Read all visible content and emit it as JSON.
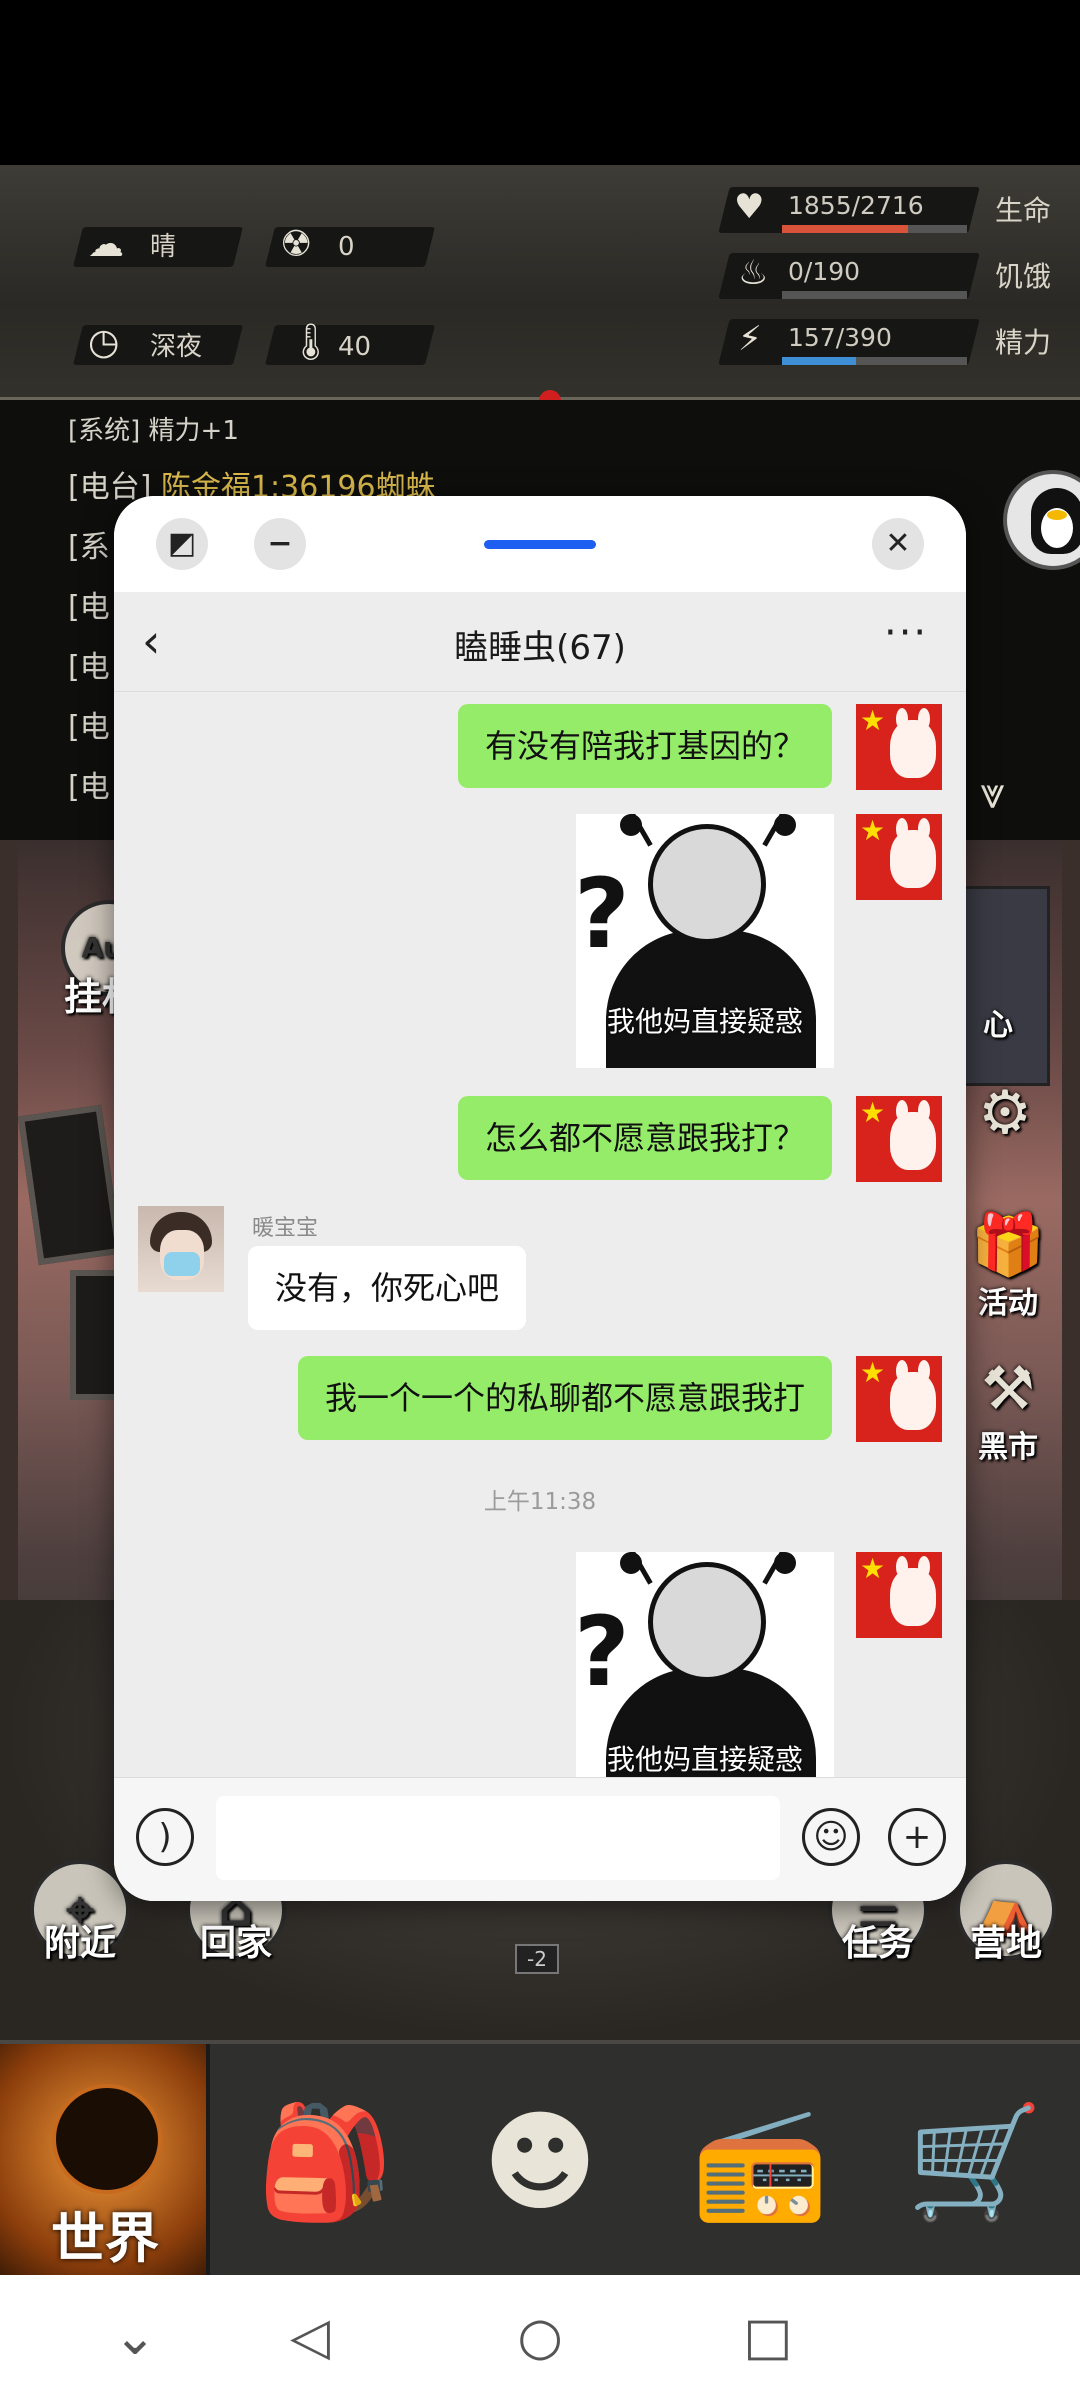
{
  "game": {
    "weather": "晴",
    "radiation": "0",
    "time_of_day": "深夜",
    "temperature": "40",
    "health": {
      "value": "1855/2716",
      "label": "生命",
      "fraction": 0.68,
      "color": "#d9533a"
    },
    "hunger": {
      "value": "0/190",
      "label": "饥饿",
      "fraction": 0.0,
      "color": "#c9a23a"
    },
    "energy": {
      "value": "157/390",
      "label": "精力",
      "fraction": 0.4,
      "color": "#3f8fd6"
    },
    "log": [
      {
        "prefix": "[系统] 精力+1",
        "gold": ""
      },
      {
        "prefix": "[电台] ",
        "gold": "陈金福1:36196蜘蛛"
      },
      {
        "prefix": "[系",
        "gold": ""
      },
      {
        "prefix": "[电",
        "gold": ""
      },
      {
        "prefix": "[电",
        "gold": ""
      },
      {
        "prefix": "[电",
        "gold": ""
      },
      {
        "prefix": "[电",
        "gold": ""
      }
    ],
    "side_buttons": {
      "auto": "挂机",
      "center": "心",
      "activity": "活动",
      "black_market": "黑市",
      "nearby": "附近",
      "home": "回家",
      "task": "任务",
      "camp": "营地",
      "map_level": "-2"
    },
    "nav": {
      "world": "世界"
    }
  },
  "chat_window": {
    "title": "瞌睡虫(67)",
    "input_placeholder": "",
    "messages": [
      {
        "type": "text",
        "from": "me",
        "text": "有没有陪我打基因的？"
      },
      {
        "type": "image",
        "from": "me",
        "caption": "我他妈直接疑惑"
      },
      {
        "type": "text",
        "from": "me",
        "text": "怎么都不愿意跟我打？"
      },
      {
        "type": "text",
        "from": "other",
        "sender": "暖宝宝",
        "text": "没有，你死心吧"
      },
      {
        "type": "text",
        "from": "me",
        "text": "我一个一个的私聊都不愿意跟我打"
      },
      {
        "type": "time",
        "text": "上午11:38"
      },
      {
        "type": "image",
        "from": "me",
        "caption": "我他妈直接疑惑"
      }
    ]
  }
}
